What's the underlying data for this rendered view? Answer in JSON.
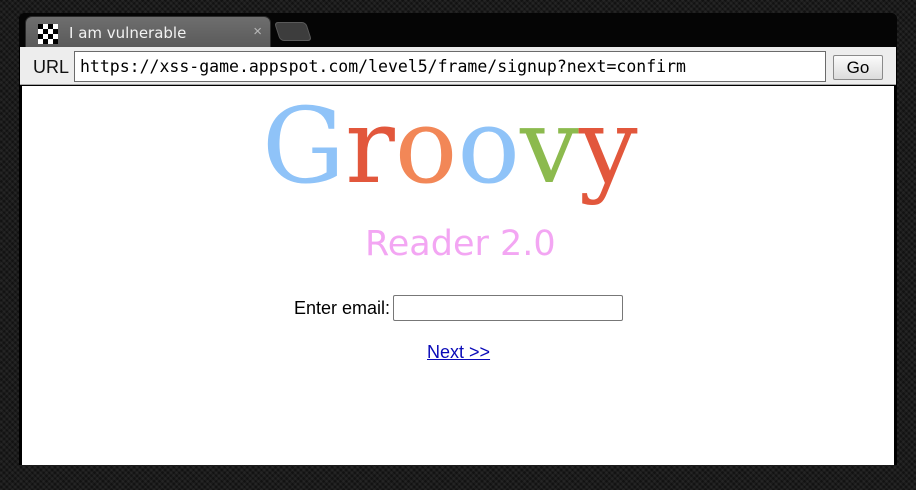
{
  "browser": {
    "tab": {
      "title": "I am vulnerable",
      "close_glyph": "×",
      "favicon": "checker-favicon-icon"
    },
    "urlbar": {
      "label": "URL",
      "value": "https://xss-game.appspot.com/level5/frame/signup?next=confirm",
      "go_label": "Go"
    }
  },
  "page": {
    "logo": {
      "word": "Groovy",
      "subtitle": "Reader 2.0",
      "letter_colors": [
        "#8fc3f8",
        "#e2573c",
        "#f28757",
        "#8fc3f8",
        "#8cba4e",
        "#e2573c"
      ],
      "subtitle_color": "#f3a6f3"
    },
    "form": {
      "email_label": "Enter email:",
      "email_value": "",
      "next_label": "Next >>"
    }
  }
}
